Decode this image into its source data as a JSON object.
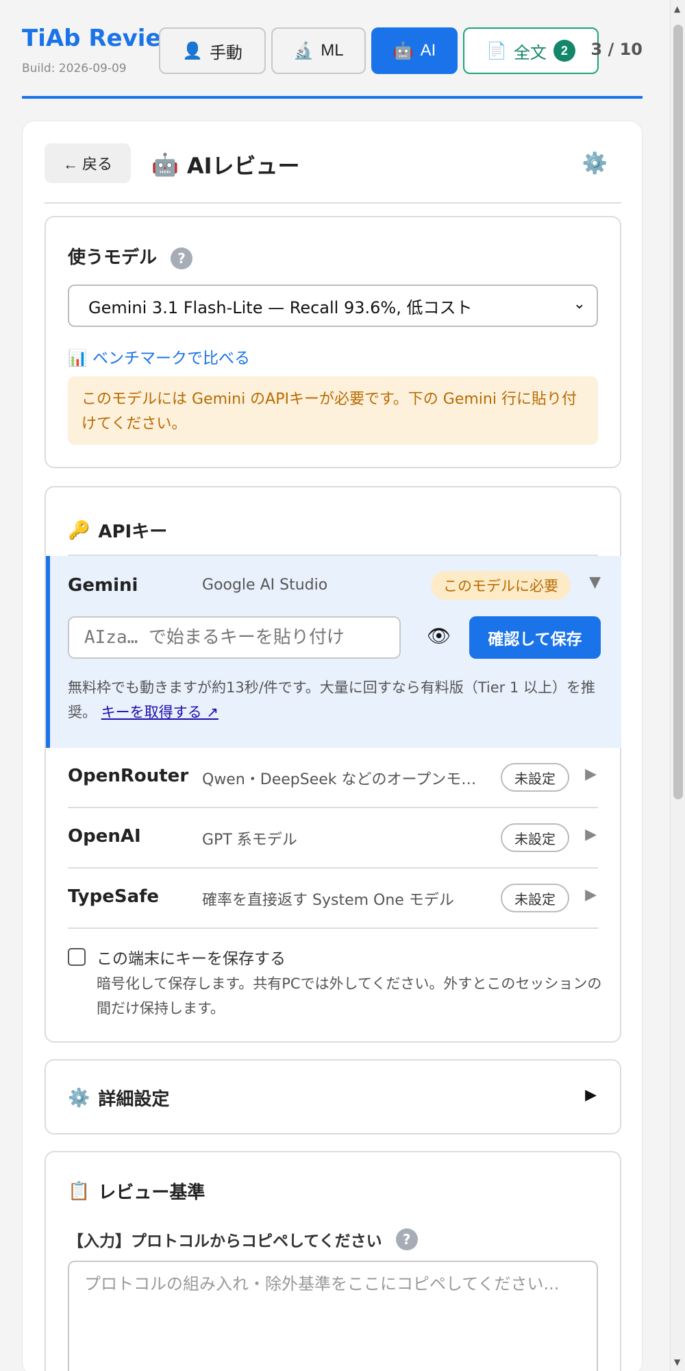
{
  "header": {
    "title": "TiAb Review",
    "build": "Build: 2026-09-09",
    "modes": {
      "manual": {
        "icon": "👤",
        "label": "手動"
      },
      "ml": {
        "icon": "🔬",
        "label": "ML"
      },
      "ai": {
        "icon": "🤖",
        "label": "AI"
      },
      "fulltext": {
        "icon": "📄",
        "label": "全文",
        "badge": "2"
      }
    },
    "progress": "3 / 10"
  },
  "panel": {
    "back_label": "← 戻る",
    "title_icon": "🤖",
    "title": "AIレビュー",
    "settings_icon": "⚙️"
  },
  "model": {
    "label": "使うモデル",
    "help": "?",
    "selected": "Gemini 3.1 Flash-Lite — Recall 93.6%, 低コスト",
    "bench_icon": "📊",
    "bench_link": "ベンチマークで比べる",
    "warning": "このモデルには Gemini のAPIキーが必要です。下の Gemini 行に貼り付けてください。"
  },
  "api": {
    "icon": "🔑",
    "title": "APIキー",
    "gemini": {
      "name": "Gemini",
      "desc": "Google AI Studio",
      "badge": "このモデルに必要",
      "placeholder": "AIza… で始まるキーを貼り付け",
      "verify_label": "確認して保存",
      "hint": "無料枠でも動きますが約13秒/件です。大量に回すなら有料版（Tier 1 以上）を推奨。",
      "get_key_link": "キーを取得する ↗"
    },
    "providers": [
      {
        "name": "OpenRouter",
        "desc": "Qwen・DeepSeek などのオープンモデル",
        "status": "未設定"
      },
      {
        "name": "OpenAI",
        "desc": "GPT 系モデル",
        "status": "未設定"
      },
      {
        "name": "TypeSafe",
        "desc": "確率を直接返す System One モデル",
        "status": "未設定"
      }
    ],
    "save_on_device_label": "この端末にキーを保存する",
    "save_on_device_note": "暗号化して保存します。共有PCでは外してください。外すとこのセッションの間だけ保持します。",
    "save_on_device_checked": false
  },
  "advanced": {
    "icon": "⚙️",
    "title": "詳細設定"
  },
  "criteria": {
    "icon": "📋",
    "title": "レビュー基準",
    "input_label": "【入力】プロトコルからコピペしてください",
    "help": "?",
    "placeholder": "プロトコルの組み入れ・除外基準をここにコピペしてください..."
  },
  "colors": {
    "accent": "#1a73e8",
    "fulltext": "#14866a",
    "warning_bg": "#fdf1dc",
    "warning_text": "#b86a00"
  }
}
